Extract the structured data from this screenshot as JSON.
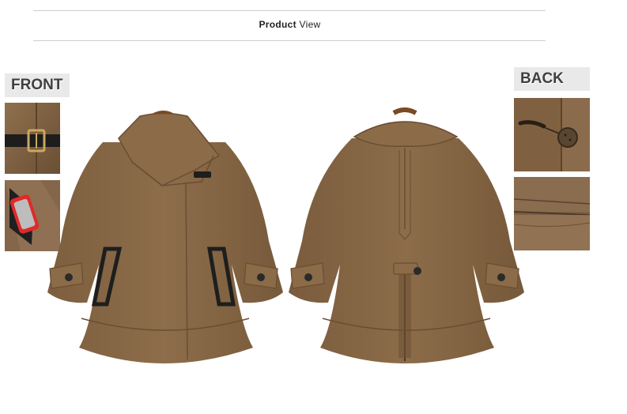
{
  "header": {
    "title_bold": "Product",
    "title_rest": "View"
  },
  "labels": {
    "front": "FRONT",
    "back": "BACK"
  },
  "colors": {
    "coat": "#8a6a47",
    "coat_dark": "#6e5236",
    "coat_light": "#9e7c56",
    "trim": "#1e1e1e",
    "label_bg": "#e9e9e9"
  }
}
